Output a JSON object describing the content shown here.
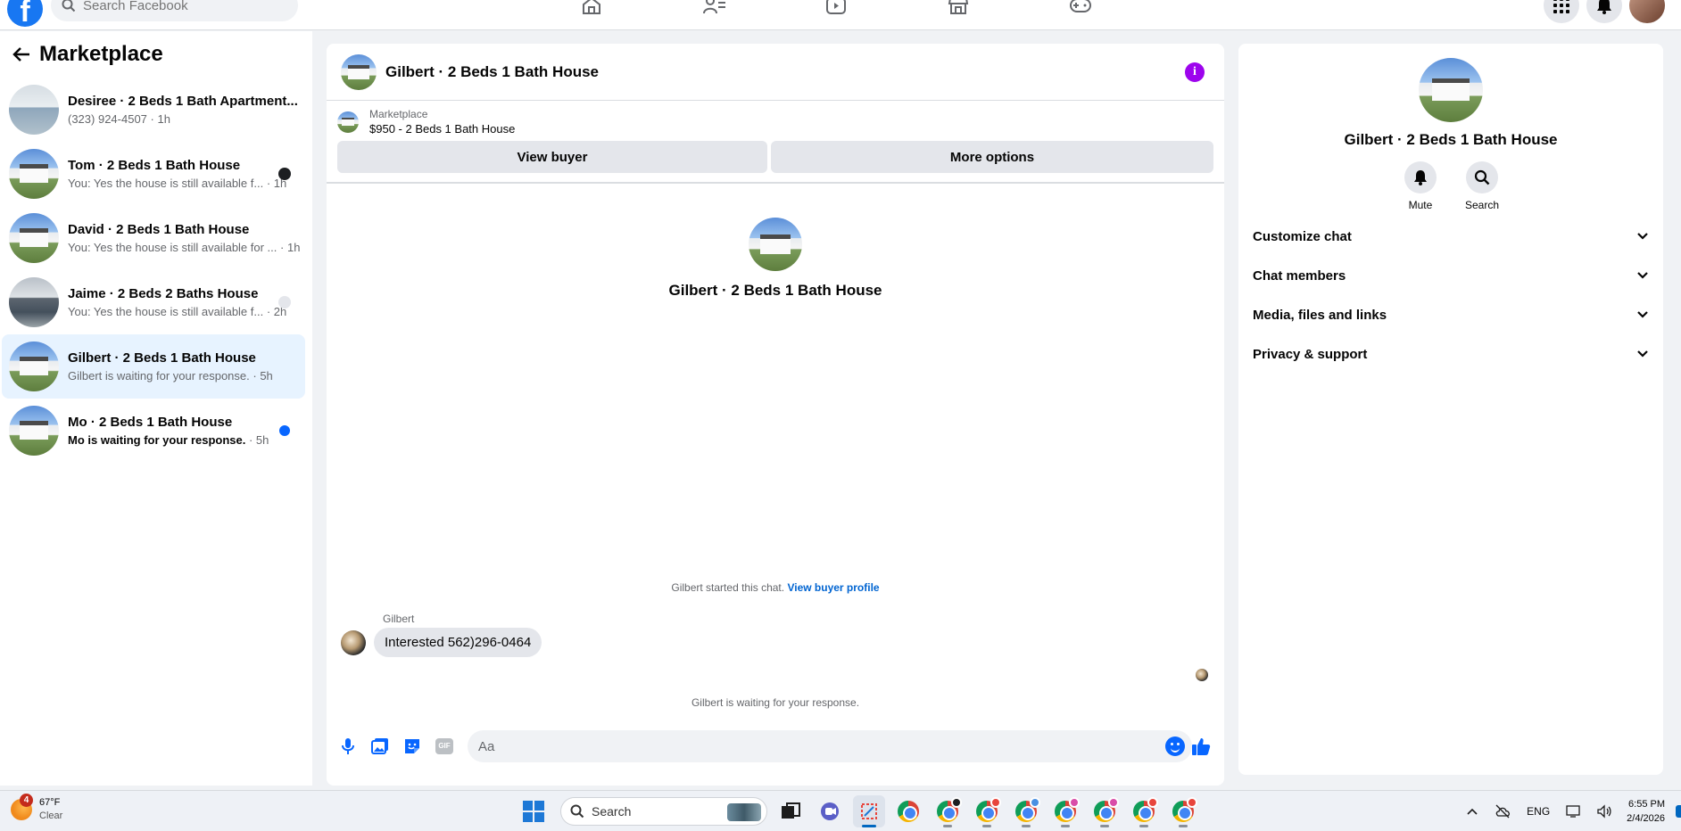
{
  "topbar": {
    "search_placeholder": "Search Facebook",
    "nav_icons": [
      "home-icon",
      "friends-icon",
      "video-icon",
      "marketplace-icon",
      "gaming-icon"
    ],
    "right_icons": [
      "menu-grid-icon",
      "bell-icon",
      "profile-avatar"
    ]
  },
  "sidebar": {
    "title": "Marketplace",
    "conversations": [
      {
        "name": "Desiree · 2 Beds 1 Bath Apartment...",
        "snippet": "(323) 924-4507",
        "time": " · 1h",
        "unread": false
      },
      {
        "name": "Tom · 2 Beds 1 Bath House",
        "snippet": "You: Yes the house is still available f...",
        "time": " · 1h",
        "unread": false
      },
      {
        "name": "David · 2 Beds 1 Bath House",
        "snippet": "You: Yes the house is still available for ...",
        "time": " · 1h",
        "unread": false
      },
      {
        "name": "Jaime · 2 Beds 2 Baths House",
        "snippet": "You: Yes the house is still available f...",
        "time": " · 2h",
        "unread": false
      },
      {
        "name": "Gilbert · 2 Beds 1 Bath House",
        "snippet": "Gilbert is waiting for your response.",
        "time": " · 5h",
        "unread": false,
        "active": true
      },
      {
        "name": "Mo · 2 Beds 1 Bath House",
        "snippet": "Mo is waiting for your response.",
        "time": " · 5h",
        "unread": true
      }
    ]
  },
  "chat": {
    "title": "Gilbert · 2 Beds 1 Bath House",
    "listing_source": "Marketplace",
    "listing_price": "$950 - 2 Beds 1 Bath House",
    "view_buyer_label": "View buyer",
    "more_options_label": "More options",
    "intro_name": "Gilbert · 2 Beds 1 Bath House",
    "started_text": "Gilbert started this chat.",
    "view_profile_link": "View buyer profile",
    "sender": "Gilbert",
    "message": "Interested 562)296-0464",
    "waiting_text": "Gilbert is waiting for your response.",
    "composer_placeholder": "Aa",
    "gif_label": "GIF"
  },
  "info_panel": {
    "name": "Gilbert · 2 Beds 1 Bath House",
    "mute_label": "Mute",
    "search_label": "Search",
    "sections": [
      "Customize chat",
      "Chat members",
      "Media, files and links",
      "Privacy & support"
    ]
  },
  "taskbar": {
    "weather_temp": "67°F",
    "weather_desc": "Clear",
    "weather_badge": "4",
    "search_label": "Search",
    "lang": "ENG",
    "time": "6:55 PM",
    "date": "2/4/2026"
  },
  "colors": {
    "accent": "#0866ff",
    "info_button": "#9d04ed",
    "active_conversation": "#e7f3ff"
  }
}
